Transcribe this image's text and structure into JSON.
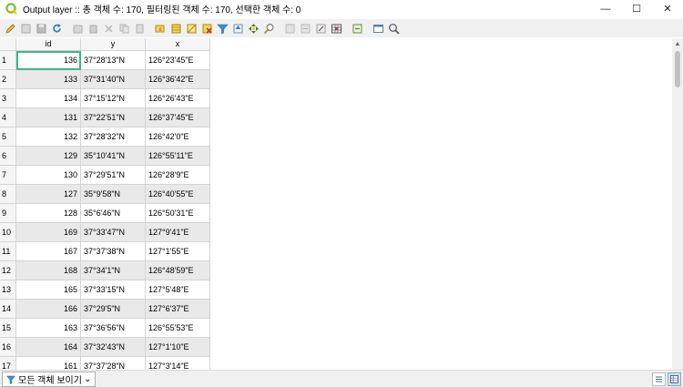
{
  "window": {
    "title": "Output layer :: 총 객체 수: 170, 필터링된 객체 수: 170, 선택한 객체 수: 0",
    "minimize": "—",
    "maximize": "☐",
    "close": "✕"
  },
  "toolbar": {
    "icons": [
      "pencil-icon",
      "multi-edit-icon",
      "save-icon",
      "reload-icon",
      "add-feature-icon",
      "delete-icon",
      "cut-icon",
      "copy-icon",
      "paste-icon",
      "select-expression-icon",
      "select-all-icon",
      "invert-selection-icon",
      "deselect-icon",
      "filter-selected-icon",
      "move-to-top-icon",
      "pan-to-selected-icon",
      "zoom-to-selected-icon",
      "new-field-icon",
      "delete-field-icon",
      "field-calculator-icon",
      "conditional-format-icon",
      "actions-icon",
      "dock-icon",
      "zoom-icon"
    ]
  },
  "table": {
    "headers": [
      "id",
      "y",
      "x"
    ],
    "rows": [
      {
        "n": "1",
        "id": "136",
        "y": "37°28'13\"N",
        "x": "126°23'45\"E"
      },
      {
        "n": "2",
        "id": "133",
        "y": "37°31'40\"N",
        "x": "126°36'42\"E"
      },
      {
        "n": "3",
        "id": "134",
        "y": "37°15'12\"N",
        "x": "126°26'43\"E"
      },
      {
        "n": "4",
        "id": "131",
        "y": "37°22'51\"N",
        "x": "126°37'45\"E"
      },
      {
        "n": "5",
        "id": "132",
        "y": "37°28'32\"N",
        "x": "126°42'0\"E"
      },
      {
        "n": "6",
        "id": "129",
        "y": "35°10'41\"N",
        "x": "126°55'11\"E"
      },
      {
        "n": "7",
        "id": "130",
        "y": "37°29'51\"N",
        "x": "126°28'9\"E"
      },
      {
        "n": "8",
        "id": "127",
        "y": "35°9'58\"N",
        "x": "126°40'55\"E"
      },
      {
        "n": "9",
        "id": "128",
        "y": "35°6'46\"N",
        "x": "126°50'31\"E"
      },
      {
        "n": "10",
        "id": "169",
        "y": "37°33'47\"N",
        "x": "127°9'41\"E"
      },
      {
        "n": "11",
        "id": "167",
        "y": "37°37'38\"N",
        "x": "127°1'55\"E"
      },
      {
        "n": "12",
        "id": "168",
        "y": "37°34'1\"N",
        "x": "126°48'59\"E"
      },
      {
        "n": "13",
        "id": "165",
        "y": "37°33'15\"N",
        "x": "127°5'48\"E"
      },
      {
        "n": "14",
        "id": "166",
        "y": "37°29'5\"N",
        "x": "127°6'37\"E"
      },
      {
        "n": "15",
        "id": "163",
        "y": "37°36'56\"N",
        "x": "126°55'53\"E"
      },
      {
        "n": "16",
        "id": "164",
        "y": "37°32'43\"N",
        "x": "127°1'10\"E"
      },
      {
        "n": "17",
        "id": "161",
        "y": "37°37'28\"N",
        "x": "127°3'14\"E"
      }
    ]
  },
  "bottom": {
    "filter_label": "모든 객체 보이기",
    "filter_arrow": "⌄"
  }
}
